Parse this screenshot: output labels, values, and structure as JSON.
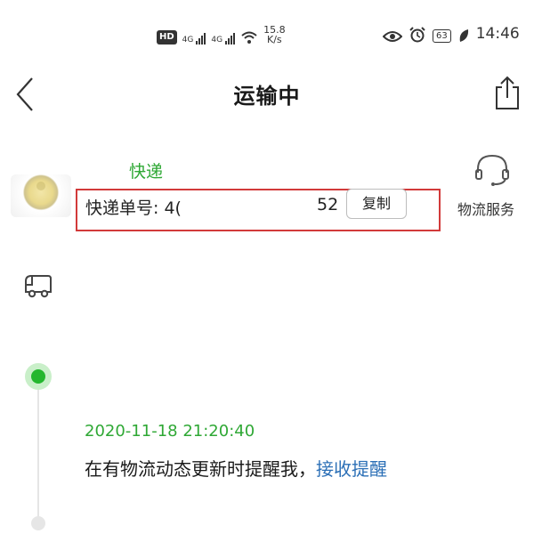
{
  "status_bar": {
    "hd": "HD",
    "net1": "4G",
    "net2": "4G",
    "speed_value": "15.8",
    "speed_unit": "K/s",
    "battery": "63",
    "time": "14:46"
  },
  "header": {
    "title": "运输中",
    "back_icon": "chevron-left-icon",
    "share_icon": "share-icon"
  },
  "courier": {
    "name": "快递",
    "tracking_label": "快递单号: 4(",
    "tracking_tail": "52",
    "copy_label": "复制"
  },
  "service": {
    "label": "物流服务",
    "icon": "headset-icon"
  },
  "timeline": {
    "entries": [
      {
        "time": "2020-11-18 21:20:40",
        "text": "在有物流动态更新时提醒我，",
        "link": "接收提醒"
      }
    ]
  },
  "colors": {
    "accent_green": "#2fa835",
    "link_blue": "#2b6fb6",
    "highlight_red": "#d23a3a"
  }
}
